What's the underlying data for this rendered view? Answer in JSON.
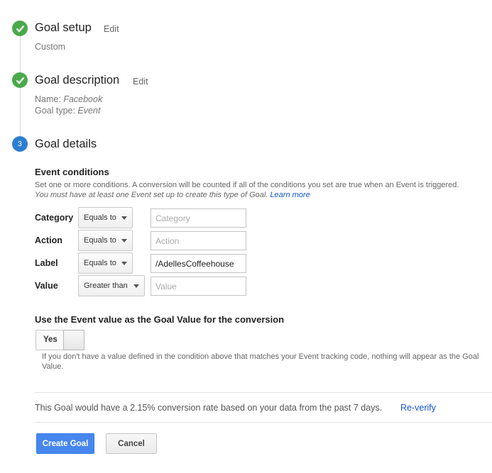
{
  "steps": [
    {
      "title": "Goal setup",
      "edit_label": "Edit",
      "summary": "Custom",
      "status": "done"
    },
    {
      "title": "Goal description",
      "edit_label": "Edit",
      "name_label": "Name:",
      "name_value": "Facebook",
      "type_label": "Goal type:",
      "type_value": "Event",
      "status": "done"
    },
    {
      "title": "Goal details",
      "number": "3",
      "status": "current"
    }
  ],
  "event_conditions": {
    "title": "Event conditions",
    "help_line1": "Set one or more conditions. A conversion will be counted if all of the conditions you set are true when an Event is triggered.",
    "help_line2": "You must have at least one Event set up to create this type of Goal.",
    "learn_more": "Learn more",
    "rows": [
      {
        "label": "Category",
        "operator": "Equals to",
        "value": "",
        "placeholder": "Category"
      },
      {
        "label": "Action",
        "operator": "Equals to",
        "value": "",
        "placeholder": "Action"
      },
      {
        "label": "Label",
        "operator": "Equals to",
        "value": "/AdellesCoffeehouse",
        "placeholder": "Label"
      },
      {
        "label": "Value",
        "operator": "Greater than",
        "value": "",
        "placeholder": "Value"
      }
    ]
  },
  "goal_value": {
    "title": "Use the Event value as the Goal Value for the conversion",
    "toggle_label": "Yes",
    "toggle_on": true,
    "help": "If you don't have a value defined in the condition above that matches your Event tracking code, nothing will appear as the Goal Value."
  },
  "verify": {
    "text": "This Goal would have a 2.15% conversion rate based on your data from the past 7 days.",
    "reverify_label": "Re-verify"
  },
  "actions": {
    "create_label": "Create Goal",
    "cancel_label": "Cancel"
  },
  "colors": {
    "done": "#4aa94a",
    "current": "#2c7fd0",
    "primary_button": "#4787ed",
    "link": "#1155cc"
  }
}
